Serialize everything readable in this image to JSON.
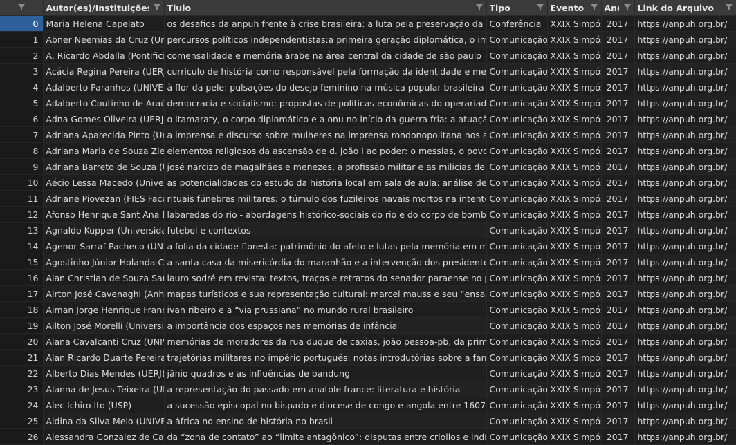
{
  "columns": {
    "index": "",
    "autor": "Autor(es)/Instituições",
    "titulo": "Tiulo",
    "tipo": "Tipo",
    "evento": "Evento",
    "ano": "Ano",
    "link": "Link do Arquivo"
  },
  "rows": [
    {
      "idx": "0",
      "autor": "Maria Helena Capelato",
      "titulo": "os desafios da anpuh frente à crise brasileira: a luta pela preservação da demo",
      "tipo": "Conferência",
      "evento": "XXIX Simpós",
      "ano": "2017",
      "link": "https://anpuh.org.br/"
    },
    {
      "idx": "1",
      "autor": "Abner Neemias da Cruz (Univ",
      "titulo": "percursos políticos independentistas:a primeira geração diplomática, o impéric",
      "tipo": "Comunicação",
      "evento": "XXIX Simpós",
      "ano": "2017",
      "link": "https://anpuh.org.br/"
    },
    {
      "idx": "2",
      "autor": "A. Ricardo Abdalla (Pontificia",
      "titulo": "comensalidade e memória árabe na área central da cidade de são paulo",
      "tipo": "Comunicação",
      "evento": "XXIX Simpós",
      "ano": "2017",
      "link": "https://anpuh.org.br/"
    },
    {
      "idx": "3",
      "autor": "Acácia Regina Pereira (UERJ",
      "titulo": "currículo de história como responsável pela formação da identidade e memória",
      "tipo": "Comunicação",
      "evento": "XXIX Simpós",
      "ano": "2017",
      "link": "https://anpuh.org.br/"
    },
    {
      "idx": "4",
      "autor": "Adalberto Paranhos (UNIVER",
      "titulo": "à flor da pele: pulsações do desejo feminino na música popular brasileira dos a",
      "tipo": "Comunicação",
      "evento": "XXIX Simpós",
      "ano": "2017",
      "link": "https://anpuh.org.br/"
    },
    {
      "idx": "5",
      "autor": "Adalberto Coutinho de Araúj",
      "titulo": "democracia e socialismo: propostas de políticas econômicas do operariado em",
      "tipo": "Comunicação",
      "evento": "XXIX Simpós",
      "ano": "2017",
      "link": "https://anpuh.org.br/"
    },
    {
      "idx": "6",
      "autor": "Adna Gomes Oliveira (UERJ)",
      "titulo": "o itamaraty, o corpo diplomático e a onu no início da  guerra fria: a atuação bra",
      "tipo": "Comunicação",
      "evento": "XXIX Simpós",
      "ano": "2017",
      "link": "https://anpuh.org.br/"
    },
    {
      "idx": "7",
      "autor": "Adriana Aparecida Pinto (Uni",
      "titulo": "a imprensa e discurso sobre mulheres na imprensa rondonopolitana nos anos f",
      "tipo": "Comunicação",
      "evento": "XXIX Simpós",
      "ano": "2017",
      "link": "https://anpuh.org.br/"
    },
    {
      "idx": "8",
      "autor": "Adriana Maria de Souza Ziere",
      "titulo": "elementos religiosos da ascensão de d. joão i ao poder: o messias, o povo e a ci",
      "tipo": "Comunicação",
      "evento": "XXIX Simpós",
      "ano": "2017",
      "link": "https://anpuh.org.br/"
    },
    {
      "idx": "9",
      "autor": "Adriana Barreto de Souza (UI",
      "titulo": "josé narcizo de magalhães e menezes, a profissão militar e as  milícias de home",
      "tipo": "Comunicação",
      "evento": "XXIX Simpós",
      "ano": "2017",
      "link": "https://anpuh.org.br/"
    },
    {
      "idx": "10",
      "autor": "Aécio Lessa Macedo (Univers",
      "titulo": "as potencialidades do estudo da história local em sala de aula: análise de uma e",
      "tipo": "Comunicação",
      "evento": "XXIX Simpós",
      "ano": "2017",
      "link": "https://anpuh.org.br/"
    },
    {
      "idx": "11",
      "autor": "Adriane Piovezan (FIES Facul",
      "titulo": "rituais fúnebres militares: o túmulo dos fuzileiros navais mortos na intentona ir",
      "tipo": "Comunicação",
      "evento": "XXIX Simpós",
      "ano": "2017",
      "link": "https://anpuh.org.br/"
    },
    {
      "idx": "12",
      "autor": "Afonso Henrique Sant Ana Ba",
      "titulo": "labaredas do rio - abordagens histórico-sociais do rio e do corpo de bombeiros",
      "tipo": "Comunicação",
      "evento": "XXIX Simpós",
      "ano": "2017",
      "link": "https://anpuh.org.br/"
    },
    {
      "idx": "13",
      "autor": "Agnaldo Kupper (Universidad",
      "titulo": "futebol e contextos",
      "tipo": "Comunicação",
      "evento": "XXIX Simpós",
      "ano": "2017",
      "link": "https://anpuh.org.br/"
    },
    {
      "idx": "14",
      "autor": "Agenor Sarraf Pacheco (UNIV",
      "titulo": "a folia da cidade-floresta: patrimônio do afeto e lutas pela memória em melgac",
      "tipo": "Comunicação",
      "evento": "XXIX Simpós",
      "ano": "2017",
      "link": "https://anpuh.org.br/"
    },
    {
      "idx": "15",
      "autor": "Agostinho Júnior Holanda Co",
      "titulo": "a santa casa da misericórdia do maranhão e a intervenção dos presidentes-pro",
      "tipo": "Comunicação",
      "evento": "XXIX Simpós",
      "ano": "2017",
      "link": "https://anpuh.org.br/"
    },
    {
      "idx": "16",
      "autor": "Alan Christian de Souza Sant",
      "titulo": "lauro sodré em revista: textos, traços e retratos do senador paraense no perioc",
      "tipo": "Comunicação",
      "evento": "XXIX Simpós",
      "ano": "2017",
      "link": "https://anpuh.org.br/"
    },
    {
      "idx": "17",
      "autor": "Airton José Cavenaghi (Anhe",
      "titulo": "mapas turísticos e sua representação cultural: marcel mauss e seu “ensaio sobr",
      "tipo": "Comunicação",
      "evento": "XXIX Simpós",
      "ano": "2017",
      "link": "https://anpuh.org.br/"
    },
    {
      "idx": "18",
      "autor": "Aiman Jorge Henrique Franc",
      "titulo": "ivan ribeiro e a “via prussiana” no mundo rural brasileiro",
      "tipo": "Comunicação",
      "evento": "XXIX Simpós",
      "ano": "2017",
      "link": "https://anpuh.org.br/"
    },
    {
      "idx": "19",
      "autor": "Ailton José Morelli (Universic",
      "titulo": "a importância dos espaços nas memórias de infância",
      "tipo": "Comunicação",
      "evento": "XXIX Simpós",
      "ano": "2017",
      "link": "https://anpuh.org.br/"
    },
    {
      "idx": "20",
      "autor": "Alana Cavalcanti Cruz (UNIVE",
      "titulo": "memórias de moradores da rua duque de caxias, joão pessoa-pb, da primeira m",
      "tipo": "Comunicação",
      "evento": "XXIX Simpós",
      "ano": "2017",
      "link": "https://anpuh.org.br/"
    },
    {
      "idx": "21",
      "autor": "Alan Ricardo Duarte Pereira (",
      "titulo": "trajetórias militares no império português: notas introdutórias sobre a família c",
      "tipo": "Comunicação",
      "evento": "XXIX Simpós",
      "ano": "2017",
      "link": "https://anpuh.org.br/"
    },
    {
      "idx": "22",
      "autor": "Alberto Dias Mendes (UERJ)",
      "titulo": "jânio quadros e as influências de bandung",
      "tipo": "Comunicação",
      "evento": "XXIX Simpós",
      "ano": "2017",
      "link": "https://anpuh.org.br/"
    },
    {
      "idx": "23",
      "autor": "Alanna de Jesus Teixeira (UFI",
      "titulo": "a representação do passado em anatole france: literatura e história",
      "tipo": "Comunicação",
      "evento": "XXIX Simpós",
      "ano": "2017",
      "link": "https://anpuh.org.br/"
    },
    {
      "idx": "24",
      "autor": "Alec Ichiro Ito (USP)",
      "titulo": "a sucessão episcopal no bispado e diocese de congo e angola entre 1607 e 161",
      "tipo": "Comunicação",
      "evento": "XXIX Simpós",
      "ano": "2017",
      "link": "https://anpuh.org.br/"
    },
    {
      "idx": "25",
      "autor": "Aldina da Silva Melo (UNIVEF",
      "titulo": "a áfrica no ensino de história no brasil",
      "tipo": "Comunicação",
      "evento": "XXIX Simpós",
      "ano": "2017",
      "link": "https://anpuh.org.br/"
    },
    {
      "idx": "26",
      "autor": "Alessandra Gonzalez de Carv",
      "titulo": "da “zona de contato” ao “limite antagônico”: disputas entre criollos e indígenas",
      "tipo": "Comunicação",
      "evento": "XXIX Simpós",
      "ano": "2017",
      "link": "https://anpuh.org.br/"
    }
  ]
}
